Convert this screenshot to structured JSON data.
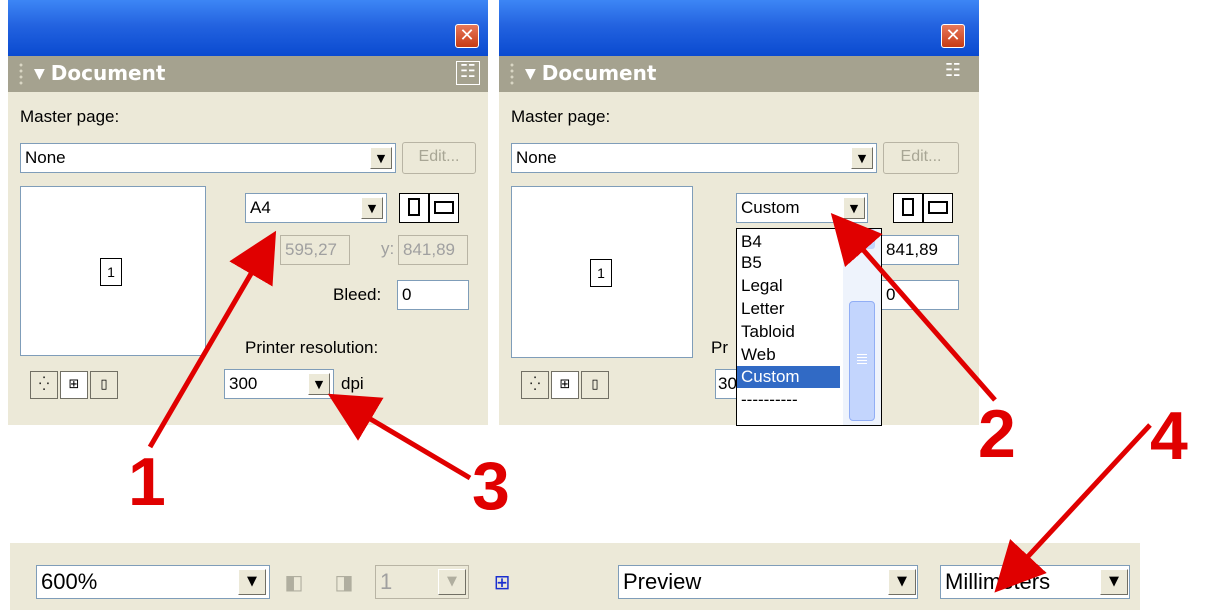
{
  "panel_left": {
    "close_symbol": "✕",
    "title": "Document",
    "master_page_label": "Master page:",
    "master_page_value": "None",
    "edit_label": "Edit...",
    "page_size_value": "A4",
    "x_label": "x:",
    "x_value": "595,27",
    "y_label": "y:",
    "y_value": "841,89",
    "page_number": "1",
    "bleed_label": "Bleed:",
    "bleed_value": "0",
    "printer_resolution_label": "Printer resolution:",
    "resolution_value": "300",
    "dpi_label": "dpi"
  },
  "panel_right": {
    "close_symbol": "✕",
    "title": "Document",
    "master_page_label": "Master page:",
    "master_page_value": "None",
    "edit_label": "Edit...",
    "page_size_value": "Custom",
    "y_value": "841,89",
    "page_number": "1",
    "bleed_value": "0",
    "printer_resolution_partial": "Pr",
    "resolution_partial": "30",
    "list_items": [
      "B4",
      "B5",
      "Legal",
      "Letter",
      "Tabloid",
      "Web",
      "Custom",
      "----------"
    ],
    "list_selected": "Custom"
  },
  "annotations": [
    "1",
    "2",
    "3",
    "4"
  ],
  "toolbar": {
    "zoom_value": "600%",
    "page_value": "1",
    "view_mode_value": "Preview",
    "units_value": "Millimeters"
  },
  "icons": {
    "dropdown": "▼",
    "menu": "☷"
  },
  "colors": {
    "arrow": "#e00000",
    "title_bar": "#2363e0",
    "selection": "#316ac5"
  }
}
